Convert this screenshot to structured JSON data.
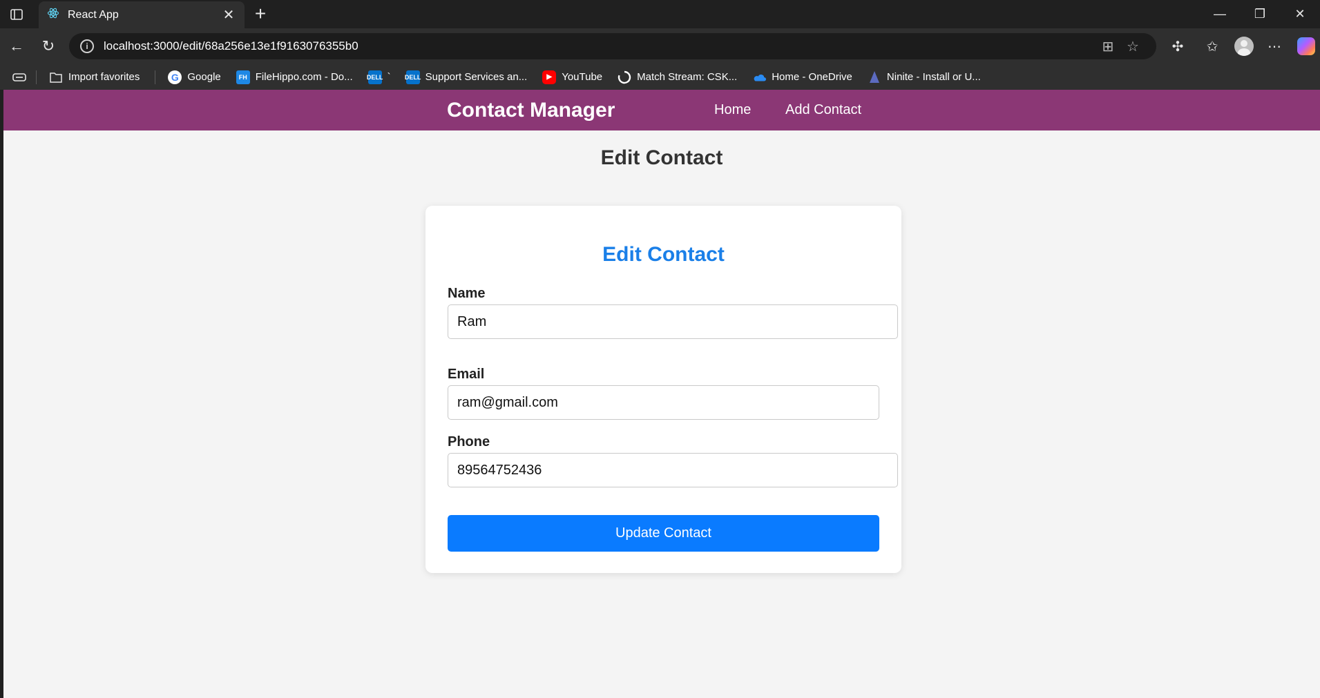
{
  "browser": {
    "tab_title": "React App",
    "address": "localhost:3000/edit/68a256e13e1f9163076355b0",
    "favorites": [
      {
        "label": "Import favorites"
      },
      {
        "label": "Google"
      },
      {
        "label": "FileHippo.com - Do..."
      },
      {
        "label": "`"
      },
      {
        "label": "Support Services an..."
      },
      {
        "label": "YouTube"
      },
      {
        "label": "Match Stream: CSK..."
      },
      {
        "label": "Home - OneDrive"
      },
      {
        "label": "Ninite - Install or U..."
      }
    ]
  },
  "app": {
    "brand": "Contact Manager",
    "nav": {
      "home": "Home",
      "add": "Add Contact"
    },
    "page_heading": "Edit Contact",
    "form": {
      "title": "Edit Contact",
      "name_label": "Name",
      "name_value": "Ram",
      "email_label": "Email",
      "email_value": "ram@gmail.com",
      "phone_label": "Phone",
      "phone_value": "89564752436",
      "submit_label": "Update Contact"
    }
  }
}
